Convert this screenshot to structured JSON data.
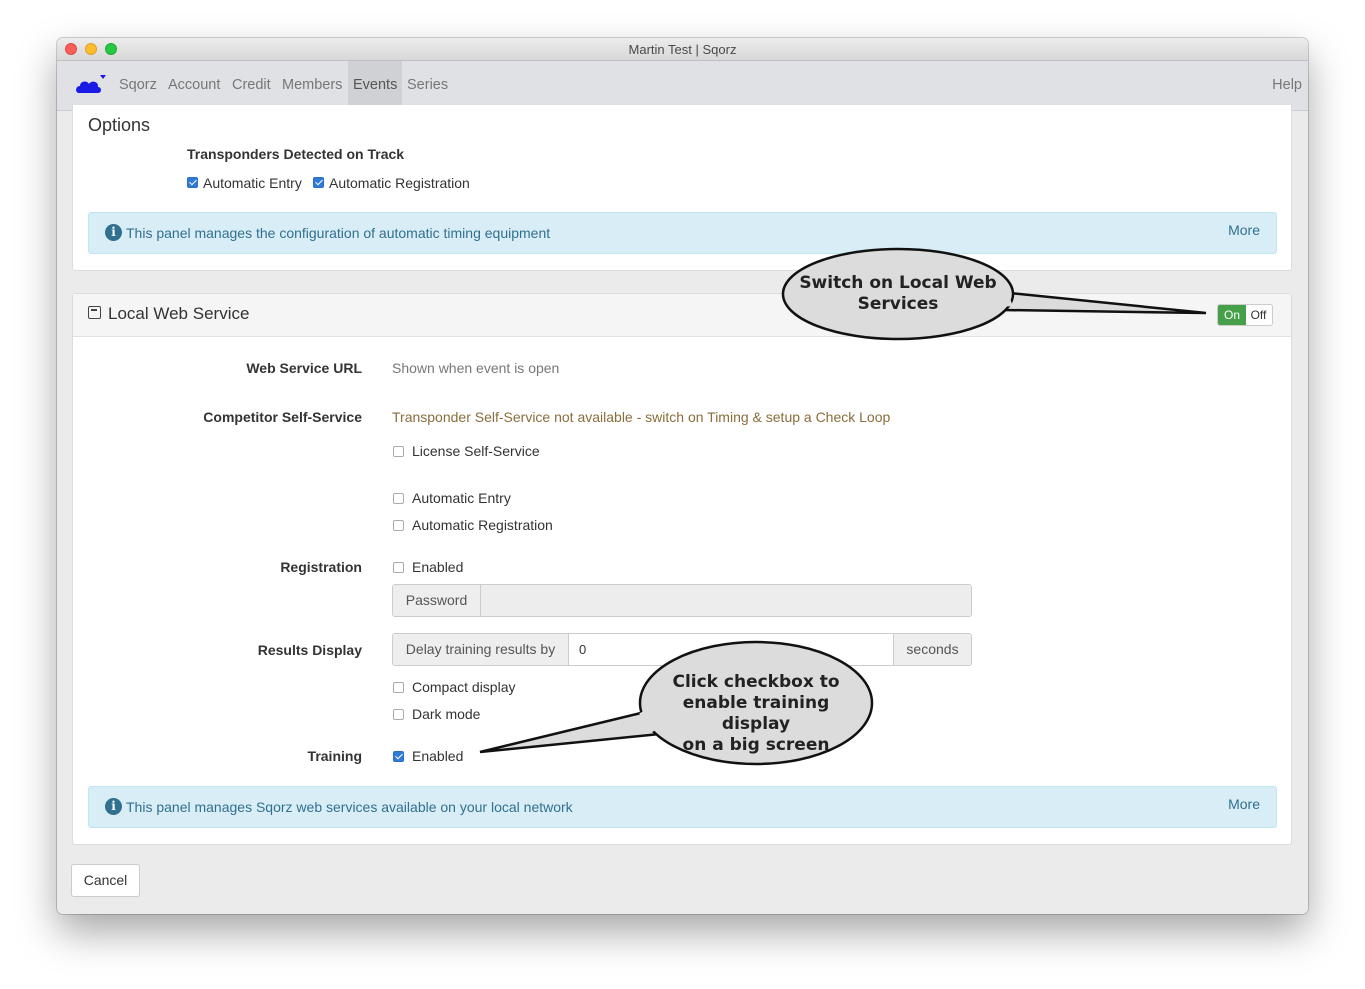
{
  "window": {
    "title": "Martin Test | Sqorz"
  },
  "nav": {
    "items": [
      {
        "label": "Sqorz"
      },
      {
        "label": "Account"
      },
      {
        "label": "Credit"
      },
      {
        "label": "Members"
      },
      {
        "label": "Events"
      },
      {
        "label": "Series"
      }
    ],
    "active": "Events",
    "help": "Help"
  },
  "options_panel": {
    "title": "Options",
    "transponders_label": "Transponders Detected on Track",
    "auto_entry": {
      "label": "Automatic Entry",
      "checked": true
    },
    "auto_registration": {
      "label": "Automatic Registration",
      "checked": true
    },
    "info": {
      "text": "This panel manages the configuration of automatic timing equipment",
      "more": "More"
    }
  },
  "lws_panel": {
    "title": "Local Web Service",
    "toggle": {
      "on_label": "On",
      "off_label": "Off",
      "state": "on"
    },
    "web_service_url": {
      "label": "Web Service URL",
      "value": "Shown when event is open"
    },
    "competitor_self_service": {
      "label": "Competitor Self-Service",
      "warning": "Transponder Self-Service not available - switch on Timing & setup a Check Loop",
      "license": {
        "label": "License Self-Service",
        "checked": false
      },
      "auto_entry": {
        "label": "Automatic Entry",
        "checked": false
      },
      "auto_registration": {
        "label": "Automatic Registration",
        "checked": false
      }
    },
    "registration": {
      "label": "Registration",
      "enabled": {
        "label": "Enabled",
        "checked": false
      },
      "password_label": "Password",
      "password_value": ""
    },
    "results_display": {
      "label": "Results Display",
      "delay_prefix": "Delay training results by",
      "delay_value": "0",
      "delay_suffix": "seconds",
      "compact": {
        "label": "Compact display",
        "checked": false
      },
      "dark": {
        "label": "Dark mode",
        "checked": false
      }
    },
    "training": {
      "label": "Training",
      "enabled": {
        "label": "Enabled",
        "checked": true
      }
    },
    "info": {
      "text": "This panel manages Sqorz web services available on your local network",
      "more": "More"
    }
  },
  "cancel_label": "Cancel",
  "callouts": {
    "switch_on": {
      "line1": "Switch on Local Web",
      "line2": "Services"
    },
    "click_checkbox": {
      "line1": "Click checkbox to",
      "line2": "enable training display",
      "line3": "on a  big screen"
    }
  },
  "colors": {
    "accent": "#2f7bd6",
    "toggle_on": "#45a049",
    "info_bg": "#d9edf7",
    "info_text": "#31708f",
    "warning": "#8a6d3b",
    "logo": "#1a1ae6"
  },
  "icons": {
    "logo": "cloud-icon",
    "info": "info-circle-icon",
    "panel_heading": "window-icon"
  }
}
